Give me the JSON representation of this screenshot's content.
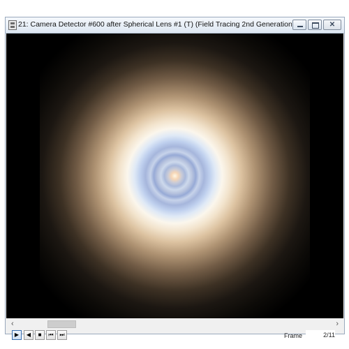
{
  "window": {
    "title": "21: Camera Detector #600 after Spherical Lens #1 (T) (Field Tracing 2nd Generation) vs. Distance Before (Ca..."
  },
  "window_buttons": {
    "minimize": "minimize-icon",
    "maximize": "maximize-icon",
    "close_glyph": "✕"
  },
  "scrollbar": {
    "left_arrow": "‹",
    "right_arrow": "›"
  },
  "playback": {
    "play": "▶",
    "step_back": "◀",
    "stop": "■",
    "first": "⏮",
    "last": "⏭"
  },
  "frame": {
    "label": "Frame",
    "value": "2/11"
  },
  "colors": {
    "background": "#000000",
    "titlebar": "#dde7f2",
    "spot_center": "#fff8e6",
    "ring_blue": "#a9b9db"
  }
}
